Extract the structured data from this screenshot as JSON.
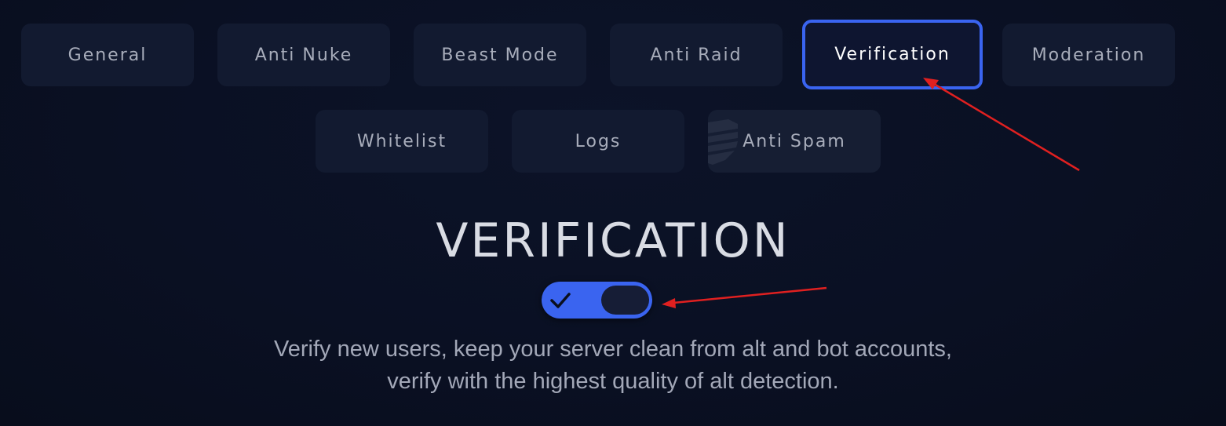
{
  "tabs": [
    {
      "label": "General"
    },
    {
      "label": "Anti Nuke"
    },
    {
      "label": "Beast Mode"
    },
    {
      "label": "Anti Raid"
    },
    {
      "label": "Verification",
      "active": true
    },
    {
      "label": "Moderation"
    },
    {
      "label": "Whitelist"
    },
    {
      "label": "Logs"
    },
    {
      "label": "Anti Spam"
    }
  ],
  "section": {
    "title": "VERIFICATION",
    "toggle_on": true,
    "description_lines": [
      "Verify new users, keep your server clean from alt and bot accounts,",
      "verify with the highest quality of alt detection."
    ]
  },
  "colors": {
    "accent": "#3a64f0",
    "annotation_arrow": "#e02020"
  },
  "icons": {
    "toggle_check": "checkmark-icon",
    "anti_spam_watermark": "shield-icon"
  }
}
